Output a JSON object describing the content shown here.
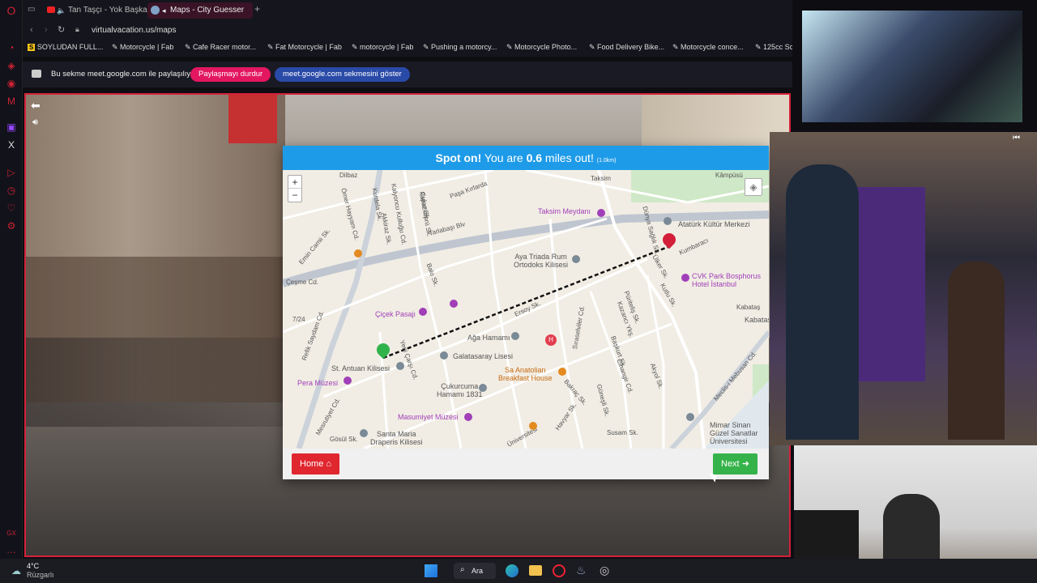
{
  "tabs": [
    {
      "label": "Tan Taşçı - Yok Başka"
    },
    {
      "label": "Maps - City Guesser"
    }
  ],
  "address": {
    "url": "virtualvacation.us/maps"
  },
  "bookmarks": [
    "SOYLUDAN FULL...",
    "Motorcycle | Fab",
    "Cafe Racer motor...",
    "Fat Motorcycle | Fab",
    "motorcycle | Fab",
    "Pushing a motorcy...",
    "Motorcycle Photo...",
    "Food Delivery Bike...",
    "Motorcycle conce...",
    "125cc Sc"
  ],
  "share": {
    "text": "Bu sekme meet.google.com ile paylaşılıyor",
    "stop_label": "Paylaşmayı durdur",
    "show_label": "meet.google.com sekmesini göster"
  },
  "modal": {
    "title_prefix": "Spot on!",
    "title_mid": " You are ",
    "distance": "0.6",
    "title_suffix": " miles out!",
    "km": "(1.0km)",
    "home_label": "Home",
    "next_label": "Next"
  },
  "map": {
    "zoom_in": "+",
    "zoom_out": "−",
    "streets": [
      "Dilbaz",
      "Taksim",
      "Kâmpüsü",
      "Ömer Hayyam Cd.",
      "Kalyoncu Kulluğu Cd.",
      "Kurdela Sk.",
      "Akkiraz Sk.",
      "Çukur Sk.",
      "Papazköprü Sk.",
      "Paşa Kırlarda",
      "Tarlabaşı Blv",
      "Emin Camii Sk.",
      "Balo Sk.",
      "Çeşme Cd.",
      "Ersoy Sk.",
      "Refik Saydam Cd.",
      "Yeni Çarşı Cd.",
      "Sıraselviler Cd.",
      "Kazancı Ykş.",
      "Başkurt Sk.",
      "Cihangir Cd.",
      "Akyol Sk.",
      "Meclis-i Mebusan Cd.",
      "Kabataş",
      "Mesrutiyet Cd.",
      "Güneşli Sk.",
      "Bakraç Sk.",
      "Havyar Sk.",
      "Susam Sk.",
      "Üniversitesi",
      "Dünya Sağlık Sk.",
      "Ülker Sk.",
      "Püriteliş Sk.",
      "Kutlu Sk.",
      "Kumbaracı",
      "Gösül Sk."
    ],
    "pois": {
      "taksim_meydani": "Taksim Meydanı",
      "ataturk": "Atatürk Kültür Merkezi",
      "aya_triada": "Aya Triada Rum\nOrtodoks Kilisesi",
      "cvk": "CVK Park Bosphorus\nHotel İstanbul",
      "cicek": "Çiçek Pasajı",
      "aga": "Ağa Hamamı",
      "galatasaray": "Galatasaray Lisesi",
      "antuan": "St. Antuan Kilisesi",
      "pera": "Pera Müzesi",
      "anatolian": "Sa Anatolian\nBreakfast House",
      "cukurcuma": "Çukurcuma\nHamamı 1831",
      "masumiyet": "Masumiyet Müzesi",
      "santa_maria": "Santa Maria\nDraperis Kilisesi",
      "mimar": "Mimar Sinan\nGüzel Sanatlar\nÜniversitesi",
      "kabatas": "Kabataş",
      "route": "7/24"
    }
  },
  "taskbar": {
    "weather_temp": "4°C",
    "weather_text": "Rüzgarlı",
    "search_label": "Ara"
  },
  "colors": {
    "accent_red": "#d4213a",
    "modal_header": "#1e9be8",
    "home_btn": "#e0262f",
    "next_btn": "#35b34a"
  }
}
